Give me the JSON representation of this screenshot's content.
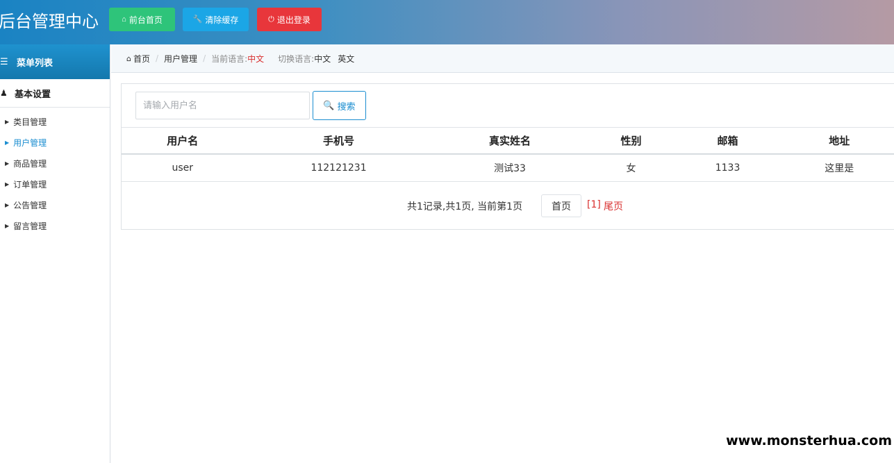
{
  "header": {
    "brand": "后台管理中心",
    "buttons": {
      "home": "前台首页",
      "clear_cache": "清除缓存",
      "logout": "退出登录"
    }
  },
  "sidebar": {
    "title": "菜单列表",
    "group": "基本设置",
    "items": [
      {
        "label": "类目管理"
      },
      {
        "label": "用户管理"
      },
      {
        "label": "商品管理"
      },
      {
        "label": "订单管理"
      },
      {
        "label": "公告管理"
      },
      {
        "label": "留言管理"
      }
    ]
  },
  "breadcrumb": {
    "home": "首页",
    "current": "用户管理",
    "lang_label": "当前语言:",
    "lang_value": "中文",
    "switch_label": "切换语言:",
    "switch_zh": "中文",
    "switch_en": "英文"
  },
  "search": {
    "placeholder": "请输入用户名",
    "button": "搜索"
  },
  "table": {
    "headers": [
      "用户名",
      "手机号",
      "真实姓名",
      "性别",
      "邮箱",
      "地址"
    ],
    "rows": [
      [
        "user",
        "112121231",
        "测试33",
        "女",
        "1133",
        "这里是"
      ]
    ]
  },
  "pager": {
    "info": "共1记录,共1页, 当前第1页",
    "first": "首页",
    "current": "[1]",
    "last": "尾页"
  },
  "watermark": "www.monsterhua.com",
  "colors": {
    "accent": "#1a8dd0",
    "green": "#2ec47a",
    "blue": "#1ba6e6",
    "red": "#e8363b"
  }
}
